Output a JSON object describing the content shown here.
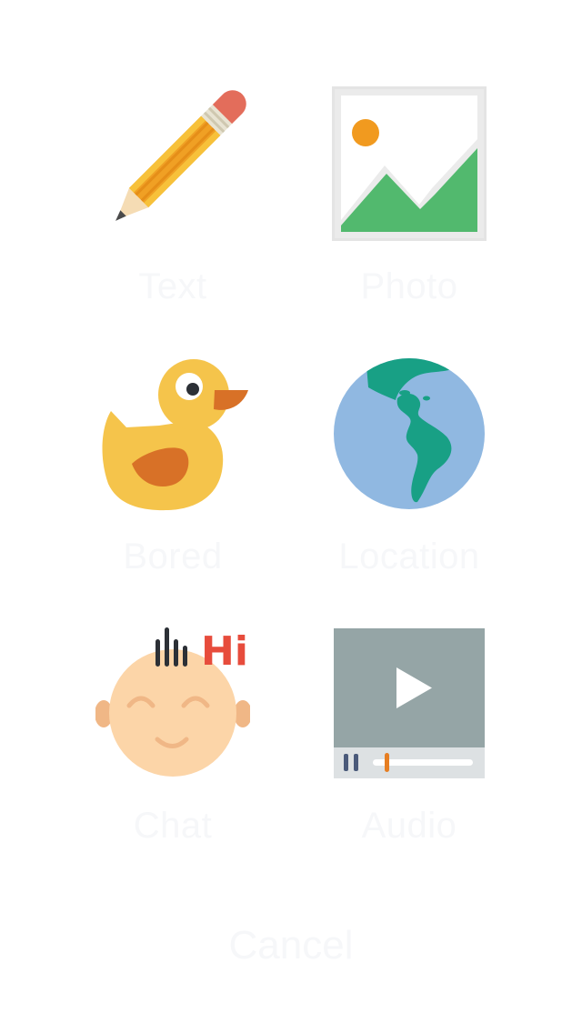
{
  "menu": {
    "items": [
      {
        "label": "Text",
        "icon": "pencil-icon"
      },
      {
        "label": "Photo",
        "icon": "photo-icon"
      },
      {
        "label": "Bored",
        "icon": "duck-icon"
      },
      {
        "label": "Location",
        "icon": "globe-icon"
      },
      {
        "label": "Chat",
        "icon": "baby-face-icon",
        "badge": "Hi"
      },
      {
        "label": "Audio",
        "icon": "video-player-icon"
      }
    ],
    "cancel_label": "Cancel"
  },
  "colors": {
    "background": "#ffffff",
    "label_text": "#f6f7f9",
    "pencil_body": "#f0a024",
    "pencil_eraser": "#e36d5b",
    "photo_sun": "#f19a1f",
    "photo_hills": "#52b96e",
    "duck_yellow": "#f5c44b",
    "duck_beak": "#d87127",
    "globe_ocean": "#90b8e1",
    "globe_land": "#18a085",
    "face_skin": "#fcd5a8",
    "chat_hi": "#e74c3c",
    "video_screen": "#95a5a6",
    "video_progress": "#e67e22"
  }
}
